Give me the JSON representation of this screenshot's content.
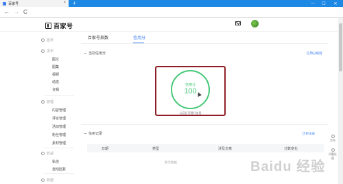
{
  "browser": {
    "tab_title": "百家号",
    "close_glyph": "×",
    "new_tab_glyph": "+",
    "window_controls": [
      "—",
      "☐",
      "✕"
    ],
    "nav": {
      "back": "←",
      "forward": "→",
      "reload": "C"
    }
  },
  "header": {
    "logo_text": "百家号",
    "mail_icon": "mail-icon",
    "avatar_color": "#46a035"
  },
  "sidebar": {
    "home": "首页",
    "groups": [
      {
        "icon": "publish-icon",
        "title": "发布",
        "items": [
          "图文",
          "图集",
          "视频",
          "动态",
          "合辑"
        ]
      },
      {
        "icon": "manage-icon",
        "title": "管理",
        "items": [
          "内容管理",
          "评论管理",
          "活动管理",
          "粉丝管理",
          "素材管理"
        ]
      },
      {
        "icon": "revenue-icon",
        "title": "收益",
        "items": [
          "私信",
          "自动回复"
        ]
      },
      {
        "icon": "data-icon",
        "title": "数据",
        "items": []
      }
    ]
  },
  "main": {
    "tabs": [
      "百家号指数",
      "信用分"
    ],
    "active_tab": "信用分",
    "current_section": "当前信用分",
    "rule_link": "信用分规则",
    "score_label": "信用分",
    "score_value": "100",
    "score_note": "认证后可提升信用",
    "record_section": "信用记录",
    "record_link": "历史记录",
    "table_headers": [
      "日期",
      "类型",
      "涉及文章",
      "分数变化"
    ],
    "empty_text": "暂无数据"
  },
  "float_actions": [
    "写作",
    "问题反馈"
  ],
  "watermark": "Baidu 经验",
  "colors": {
    "accent": "#3d7df2",
    "score_green": "#46c878",
    "highlight_border": "#8e1f26",
    "browser_bar": "#1e88e5"
  }
}
